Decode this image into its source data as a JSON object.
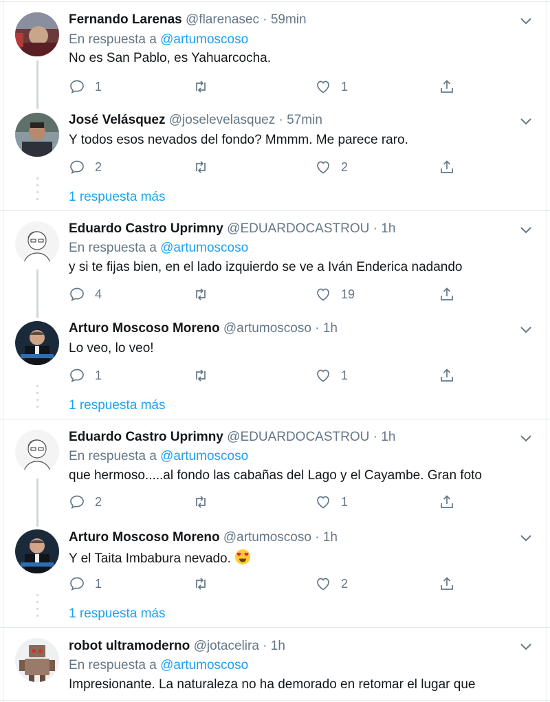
{
  "tweets": [
    {
      "name": "Fernando Larenas",
      "handle": "@flarenasec",
      "time": "59min",
      "reply_prefix": "En respuesta a",
      "reply_to": "@artumoscoso",
      "text": "No es San Pablo, es Yahuarcocha.",
      "replies": "1",
      "retweets": "",
      "likes": "1"
    },
    {
      "name": "José Velásquez",
      "handle": "@joselevelasquez",
      "time": "57min",
      "text": "Y todos esos nevados del fondo? Mmmm. Me parece raro.",
      "replies": "2",
      "retweets": "",
      "likes": "2"
    },
    {
      "name": "Eduardo Castro Uprimny",
      "handle": "@EDUARDOCASTROU",
      "time": "1h",
      "reply_prefix": "En respuesta a",
      "reply_to": "@artumoscoso",
      "text": "y si te fijas bien, en el lado izquierdo se ve a Iván Enderica nadando",
      "replies": "4",
      "retweets": "",
      "likes": "19"
    },
    {
      "name": "Arturo Moscoso Moreno",
      "handle": "@artumoscoso",
      "time": "1h",
      "text": "Lo veo, lo veo!",
      "replies": "1",
      "retweets": "",
      "likes": "1"
    },
    {
      "name": "Eduardo Castro Uprimny",
      "handle": "@EDUARDOCASTROU",
      "time": "1h",
      "reply_prefix": "En respuesta a",
      "reply_to": "@artumoscoso",
      "text": "que hermoso.....al fondo las cabañas del Lago y el Cayambe. Gran foto",
      "replies": "2",
      "retweets": "",
      "likes": "1"
    },
    {
      "name": "Arturo Moscoso Moreno",
      "handle": "@artumoscoso",
      "time": "1h",
      "text": "Y el Taita Imbabura nevado.",
      "emoji": "heart-eyes-emoji",
      "replies": "1",
      "retweets": "",
      "likes": "2"
    },
    {
      "name": "robot ultramoderno",
      "handle": "@jotacelira",
      "time": "1h",
      "reply_prefix": "En respuesta a",
      "reply_to": "@artumoscoso",
      "text": "Impresionante. La naturaleza no ha demorado en retomar el lugar que"
    }
  ],
  "more_replies_label": "1 respuesta más",
  "separator": "·",
  "icons": {
    "reply": "reply-icon",
    "retweet": "retweet-icon",
    "like": "like-icon",
    "share": "share-icon",
    "menu": "chevron-down-icon"
  },
  "colors": {
    "link": "#1da1f2",
    "muted": "#657786",
    "text": "#14171a",
    "border": "#e1e8ed"
  }
}
